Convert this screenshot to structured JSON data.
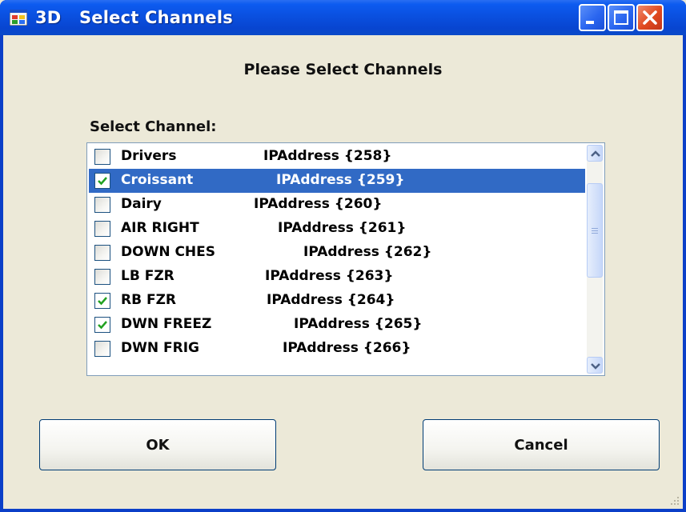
{
  "window": {
    "title": "3D   Select Channels",
    "icon": "app-window-icon",
    "controls": [
      "minimize-icon",
      "maximize-icon",
      "close-icon"
    ]
  },
  "heading": "Please Select Channels",
  "list_label": "Select Channel:",
  "channels": [
    {
      "name": "Drivers",
      "ip": "IPAddress {258}",
      "checked": false,
      "selected": false
    },
    {
      "name": "Croissant",
      "ip": "IPAddress {259}",
      "checked": true,
      "selected": true
    },
    {
      "name": "Dairy",
      "ip": "IPAddress {260}",
      "checked": false,
      "selected": false
    },
    {
      "name": "AIR RIGHT",
      "ip": "IPAddress {261}",
      "checked": false,
      "selected": false
    },
    {
      "name": "DOWN CHES",
      "ip": "IPAddress {262}",
      "checked": false,
      "selected": false
    },
    {
      "name": "LB FZR",
      "ip": "IPAddress {263}",
      "checked": false,
      "selected": false
    },
    {
      "name": "RB FZR",
      "ip": "IPAddress {264}",
      "checked": true,
      "selected": false
    },
    {
      "name": "DWN FREEZ",
      "ip": "IPAddress {265}",
      "checked": true,
      "selected": false
    },
    {
      "name": "DWN FRIG",
      "ip": "IPAddress {266}",
      "checked": false,
      "selected": false
    }
  ],
  "buttons": {
    "ok": "OK",
    "cancel": "Cancel"
  },
  "colors": {
    "titlebar": "#0a50e0",
    "selection": "#316ac5",
    "check": "#21a121",
    "dialog_bg": "#ece9d8"
  }
}
